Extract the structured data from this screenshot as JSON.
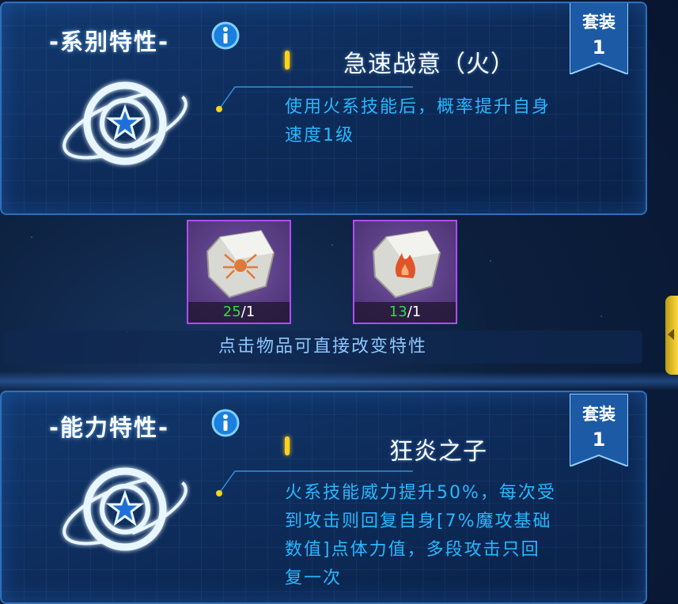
{
  "colors": {
    "panel_border": "#2f6fb8",
    "trait_desc": "#27b8ff",
    "item_have": "#2fdc4a",
    "item_border": "#b24bff",
    "accent_yellow": "#ffd21c",
    "set_tag": "#1c5aa6"
  },
  "series_trait": {
    "title": "-系别特性-",
    "info_icon": "info-icon",
    "emblem_icon": "star-orbit-emblem-icon",
    "set_tag": {
      "label": "套装",
      "number": "1"
    },
    "name": "急速战意（火）",
    "description_lines": [
      "使用火系技能后，概率提升自身",
      "速度1级"
    ]
  },
  "items": [
    {
      "icon": "spider-rune-stone-icon",
      "have": "25",
      "need": "/1"
    },
    {
      "icon": "flame-rune-stone-icon",
      "have": "13",
      "need": "/1"
    }
  ],
  "hint": "点击物品可直接改变特性",
  "ability_trait": {
    "title": "-能力特性-",
    "info_icon": "info-icon",
    "emblem_icon": "star-orbit-emblem-icon",
    "set_tag": {
      "label": "套装",
      "number": "1"
    },
    "name": "狂炎之子",
    "description_lines": [
      "火系技能威力提升50%，每次受",
      "到攻击则回复自身[7%魔攻基础",
      "数值]点体力值，多段攻击只回",
      "复一次"
    ]
  }
}
